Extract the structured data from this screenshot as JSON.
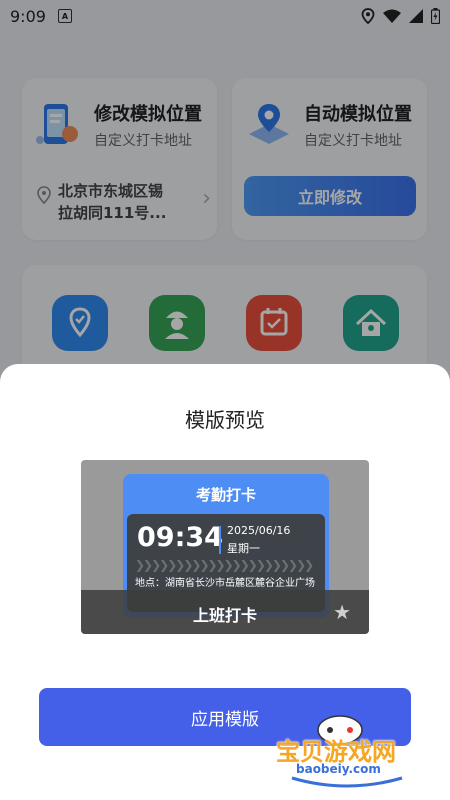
{
  "status_bar": {
    "time": "9:09",
    "a_badge": "A"
  },
  "card_modify": {
    "title": "修改模拟位置",
    "subtitle": "自定义打卡地址",
    "address_line1": "北京市东城区锡",
    "address_line2": "拉胡同111号..."
  },
  "card_auto": {
    "title": "自动模拟位置",
    "subtitle": "自定义打卡地址",
    "button_label": "立即修改"
  },
  "icons": [
    "location-app-icon",
    "worker-app-icon",
    "calendar-app-icon",
    "home-repair-app-icon"
  ],
  "sheet": {
    "title": "模版预览",
    "apply_label": "应用模版"
  },
  "preview": {
    "header": "考勤打卡",
    "time": "09:34",
    "date": "2025/06/16",
    "weekday": "星期一",
    "location": "地点：湖南省长沙市岳麓区麓谷企业广场",
    "punch_label": "上班打卡"
  },
  "watermark": {
    "text": "宝贝游戏网",
    "url": "baobeiy.com"
  },
  "colors": {
    "accent": "#4560e8",
    "preview_blue": "#4e8df3"
  }
}
